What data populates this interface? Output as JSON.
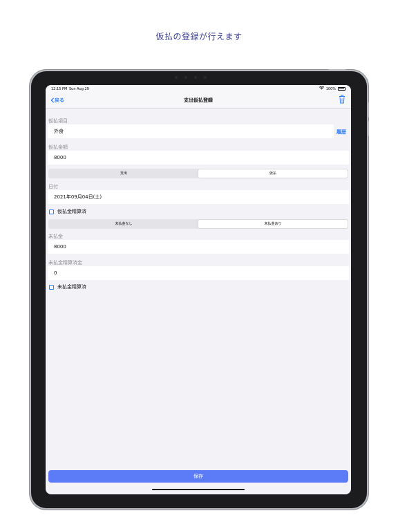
{
  "headline": "仮払の登録が行えます",
  "status_bar": {
    "time": "12:15 PM",
    "date": "Sun Aug 29",
    "battery": "100%"
  },
  "nav": {
    "back_label": "戻る",
    "title": "支出仮払登録",
    "trash_icon": "trash-icon"
  },
  "form": {
    "item_label": "仮払項目",
    "item_value": "外食",
    "history_label": "履歴",
    "amount_label": "仮払金額",
    "amount_value": "8000",
    "type_segment": {
      "options": [
        "支出",
        "仮払"
      ],
      "selected": "仮払"
    },
    "date_label": "日付",
    "date_value": "2021年09月04日(土)",
    "settled_checkbox_label": "仮払金精算済",
    "unpaid_segment": {
      "options": [
        "未払金なし",
        "未払金あり"
      ],
      "selected": "未払金あり"
    },
    "unpaid_label": "未払金",
    "unpaid_value": "8000",
    "unpaid_settled_amount_label": "未払金精算済金",
    "unpaid_settled_amount_value": "0",
    "unpaid_settled_checkbox_label": "未払金精算済"
  },
  "save_label": "保存",
  "colors": {
    "accent": "#2f7cf6",
    "save_button": "#5c7cf7",
    "headline": "#3a3f8f"
  }
}
